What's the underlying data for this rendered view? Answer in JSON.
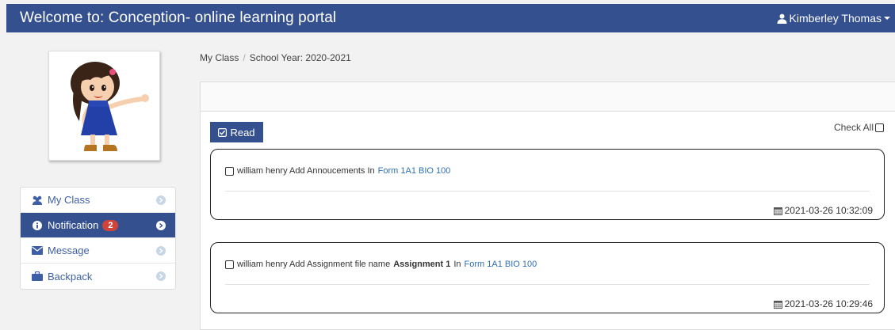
{
  "header": {
    "title": "Welcome to: Conception- online learning portal",
    "user_name": "Kimberley Thomas"
  },
  "sidebar": {
    "items": [
      {
        "label": "My Class",
        "icon": "users-icon"
      },
      {
        "label": "Notification",
        "icon": "info-icon",
        "badge": "2",
        "active": true
      },
      {
        "label": "Message",
        "icon": "envelope-icon"
      },
      {
        "label": "Backpack",
        "icon": "briefcase-icon"
      }
    ]
  },
  "breadcrumb": {
    "root": "My Class",
    "current": "School Year: 2020-2021"
  },
  "toolbar": {
    "read_label": "Read",
    "check_all_label": "Check All"
  },
  "notifications": [
    {
      "text": "william henry Add Annoucements In",
      "link": "Form 1A1 BIO 100",
      "timestamp": "2021-03-26 10:32:09"
    },
    {
      "text_pre": "william henry Add Assignment file name",
      "bold": "Assignment 1",
      "text_post": "In",
      "link": "Form 1A1 BIO 100",
      "timestamp": "2021-03-26 10:29:46"
    }
  ],
  "colors": {
    "brand": "#34508f",
    "badge": "#d0433b",
    "link": "#2e6fb5"
  }
}
